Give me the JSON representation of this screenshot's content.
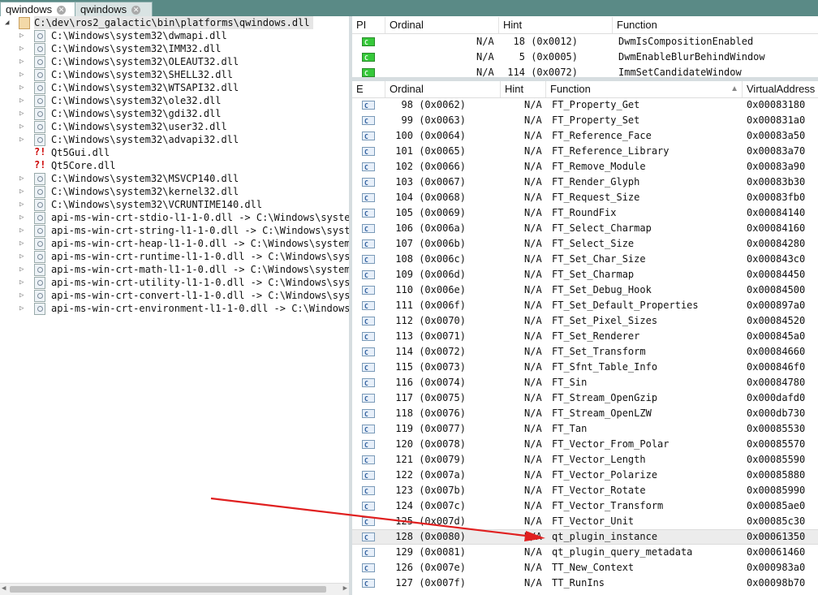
{
  "tabs": [
    {
      "label": "qwindows",
      "close_icon": "close-icon"
    },
    {
      "label": "qwindows",
      "close_icon": "close-icon"
    }
  ],
  "tree": {
    "root": "C:\\dev\\ros2_galactic\\bin\\platforms\\qwindows.dll",
    "children": [
      {
        "label": "C:\\Windows\\system32\\dwmapi.dll",
        "icon": "module-icon"
      },
      {
        "label": "C:\\Windows\\system32\\IMM32.dll",
        "icon": "module-icon"
      },
      {
        "label": "C:\\Windows\\system32\\OLEAUT32.dll",
        "icon": "module-icon"
      },
      {
        "label": "C:\\Windows\\system32\\SHELL32.dll",
        "icon": "module-icon"
      },
      {
        "label": "C:\\Windows\\system32\\WTSAPI32.dll",
        "icon": "module-icon"
      },
      {
        "label": "C:\\Windows\\system32\\ole32.dll",
        "icon": "module-icon"
      },
      {
        "label": "C:\\Windows\\system32\\gdi32.dll",
        "icon": "module-icon"
      },
      {
        "label": "C:\\Windows\\system32\\user32.dll",
        "icon": "module-icon"
      },
      {
        "label": "C:\\Windows\\system32\\advapi32.dll",
        "icon": "module-icon"
      },
      {
        "label": "Qt5Gui.dll",
        "icon": "missing-module-icon"
      },
      {
        "label": "Qt5Core.dll",
        "icon": "missing-module-icon"
      },
      {
        "label": "C:\\Windows\\system32\\MSVCP140.dll",
        "icon": "module-icon"
      },
      {
        "label": "C:\\Windows\\system32\\kernel32.dll",
        "icon": "module-icon"
      },
      {
        "label": "C:\\Windows\\system32\\VCRUNTIME140.dll",
        "icon": "module-icon"
      },
      {
        "label": "api-ms-win-crt-stdio-l1-1-0.dll -> C:\\Windows\\syste",
        "icon": "module-icon"
      },
      {
        "label": "api-ms-win-crt-string-l1-1-0.dll -> C:\\Windows\\syst",
        "icon": "module-icon"
      },
      {
        "label": "api-ms-win-crt-heap-l1-1-0.dll -> C:\\Windows\\system",
        "icon": "module-icon"
      },
      {
        "label": "api-ms-win-crt-runtime-l1-1-0.dll -> C:\\Windows\\sys",
        "icon": "module-icon"
      },
      {
        "label": "api-ms-win-crt-math-l1-1-0.dll -> C:\\Windows\\system",
        "icon": "module-icon"
      },
      {
        "label": "api-ms-win-crt-utility-l1-1-0.dll -> C:\\Windows\\sys",
        "icon": "module-icon"
      },
      {
        "label": "api-ms-win-crt-convert-l1-1-0.dll -> C:\\Windows\\sys",
        "icon": "module-icon"
      },
      {
        "label": "api-ms-win-crt-environment-l1-1-0.dll -> C:\\Windows",
        "icon": "module-icon"
      }
    ]
  },
  "imports": {
    "headers": {
      "pi": "PI",
      "ordinal": "Ordinal",
      "hint": "Hint",
      "function": "Function"
    },
    "rows": [
      {
        "ordinal": "N/A",
        "hint": "18 (0x0012)",
        "function": "DwmIsCompositionEnabled"
      },
      {
        "ordinal": "N/A",
        "hint": "5 (0x0005)",
        "function": "DwmEnableBlurBehindWindow"
      },
      {
        "ordinal": "N/A",
        "hint": "114 (0x0072)",
        "function": "ImmSetCandidateWindow"
      }
    ]
  },
  "exports": {
    "headers": {
      "e": "E",
      "ordinal": "Ordinal",
      "hint": "Hint",
      "function": "Function",
      "address": "VirtualAddress"
    },
    "selected_index": 28,
    "rows": [
      {
        "ordinal": "98 (0x0062)",
        "hint": "N/A",
        "function": "FT_Property_Get",
        "address": "0x00083180"
      },
      {
        "ordinal": "99 (0x0063)",
        "hint": "N/A",
        "function": "FT_Property_Set",
        "address": "0x000831a0"
      },
      {
        "ordinal": "100 (0x0064)",
        "hint": "N/A",
        "function": "FT_Reference_Face",
        "address": "0x00083a50"
      },
      {
        "ordinal": "101 (0x0065)",
        "hint": "N/A",
        "function": "FT_Reference_Library",
        "address": "0x00083a70"
      },
      {
        "ordinal": "102 (0x0066)",
        "hint": "N/A",
        "function": "FT_Remove_Module",
        "address": "0x00083a90"
      },
      {
        "ordinal": "103 (0x0067)",
        "hint": "N/A",
        "function": "FT_Render_Glyph",
        "address": "0x00083b30"
      },
      {
        "ordinal": "104 (0x0068)",
        "hint": "N/A",
        "function": "FT_Request_Size",
        "address": "0x00083fb0"
      },
      {
        "ordinal": "105 (0x0069)",
        "hint": "N/A",
        "function": "FT_RoundFix",
        "address": "0x00084140"
      },
      {
        "ordinal": "106 (0x006a)",
        "hint": "N/A",
        "function": "FT_Select_Charmap",
        "address": "0x00084160"
      },
      {
        "ordinal": "107 (0x006b)",
        "hint": "N/A",
        "function": "FT_Select_Size",
        "address": "0x00084280"
      },
      {
        "ordinal": "108 (0x006c)",
        "hint": "N/A",
        "function": "FT_Set_Char_Size",
        "address": "0x000843c0"
      },
      {
        "ordinal": "109 (0x006d)",
        "hint": "N/A",
        "function": "FT_Set_Charmap",
        "address": "0x00084450"
      },
      {
        "ordinal": "110 (0x006e)",
        "hint": "N/A",
        "function": "FT_Set_Debug_Hook",
        "address": "0x00084500"
      },
      {
        "ordinal": "111 (0x006f)",
        "hint": "N/A",
        "function": "FT_Set_Default_Properties",
        "address": "0x000897a0"
      },
      {
        "ordinal": "112 (0x0070)",
        "hint": "N/A",
        "function": "FT_Set_Pixel_Sizes",
        "address": "0x00084520"
      },
      {
        "ordinal": "113 (0x0071)",
        "hint": "N/A",
        "function": "FT_Set_Renderer",
        "address": "0x000845a0"
      },
      {
        "ordinal": "114 (0x0072)",
        "hint": "N/A",
        "function": "FT_Set_Transform",
        "address": "0x00084660"
      },
      {
        "ordinal": "115 (0x0073)",
        "hint": "N/A",
        "function": "FT_Sfnt_Table_Info",
        "address": "0x000846f0"
      },
      {
        "ordinal": "116 (0x0074)",
        "hint": "N/A",
        "function": "FT_Sin",
        "address": "0x00084780"
      },
      {
        "ordinal": "117 (0x0075)",
        "hint": "N/A",
        "function": "FT_Stream_OpenGzip",
        "address": "0x000dafd0"
      },
      {
        "ordinal": "118 (0x0076)",
        "hint": "N/A",
        "function": "FT_Stream_OpenLZW",
        "address": "0x000db730"
      },
      {
        "ordinal": "119 (0x0077)",
        "hint": "N/A",
        "function": "FT_Tan",
        "address": "0x00085530"
      },
      {
        "ordinal": "120 (0x0078)",
        "hint": "N/A",
        "function": "FT_Vector_From_Polar",
        "address": "0x00085570"
      },
      {
        "ordinal": "121 (0x0079)",
        "hint": "N/A",
        "function": "FT_Vector_Length",
        "address": "0x00085590"
      },
      {
        "ordinal": "122 (0x007a)",
        "hint": "N/A",
        "function": "FT_Vector_Polarize",
        "address": "0x00085880"
      },
      {
        "ordinal": "123 (0x007b)",
        "hint": "N/A",
        "function": "FT_Vector_Rotate",
        "address": "0x00085990"
      },
      {
        "ordinal": "124 (0x007c)",
        "hint": "N/A",
        "function": "FT_Vector_Transform",
        "address": "0x00085ae0"
      },
      {
        "ordinal": "125 (0x007d)",
        "hint": "N/A",
        "function": "FT_Vector_Unit",
        "address": "0x00085c30"
      },
      {
        "ordinal": "128 (0x0080)",
        "hint": "N/A",
        "function": "qt_plugin_instance",
        "address": "0x00061350"
      },
      {
        "ordinal": "129 (0x0081)",
        "hint": "N/A",
        "function": "qt_plugin_query_metadata",
        "address": "0x00061460"
      },
      {
        "ordinal": "126 (0x007e)",
        "hint": "N/A",
        "function": "TT_New_Context",
        "address": "0x000983a0"
      },
      {
        "ordinal": "127 (0x007f)",
        "hint": "N/A",
        "function": "TT_RunIns",
        "address": "0x00098b70"
      }
    ]
  },
  "annotation": {
    "arrow_color": "#e02020"
  }
}
